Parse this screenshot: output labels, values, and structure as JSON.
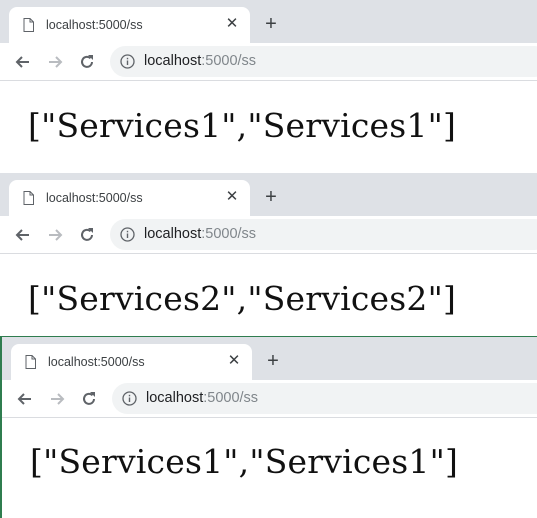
{
  "windows": [
    {
      "tab_title": "localhost:5000/ss",
      "url_host": "localhost",
      "url_path": ":5000/ss",
      "body_text": "[\"Services1\",\"Services1\"]"
    },
    {
      "tab_title": "localhost:5000/ss",
      "url_host": "localhost",
      "url_path": ":5000/ss",
      "body_text": "[\"Services2\",\"Services2\"]"
    },
    {
      "tab_title": "localhost:5000/ss",
      "url_host": "localhost",
      "url_path": ":5000/ss",
      "body_text": "[\"Services1\",\"Services1\"]"
    }
  ],
  "icons": {
    "page": "page-icon",
    "close": "close-icon",
    "new_tab": "plus-icon",
    "back": "back-arrow-icon",
    "forward": "forward-arrow-icon",
    "reload": "reload-icon",
    "info": "info-icon"
  },
  "colors": {
    "tabstrip": "#dee1e6",
    "omnibox": "#f1f3f4",
    "url_path": "#80868b",
    "focus_border": "#2f7d4f"
  }
}
